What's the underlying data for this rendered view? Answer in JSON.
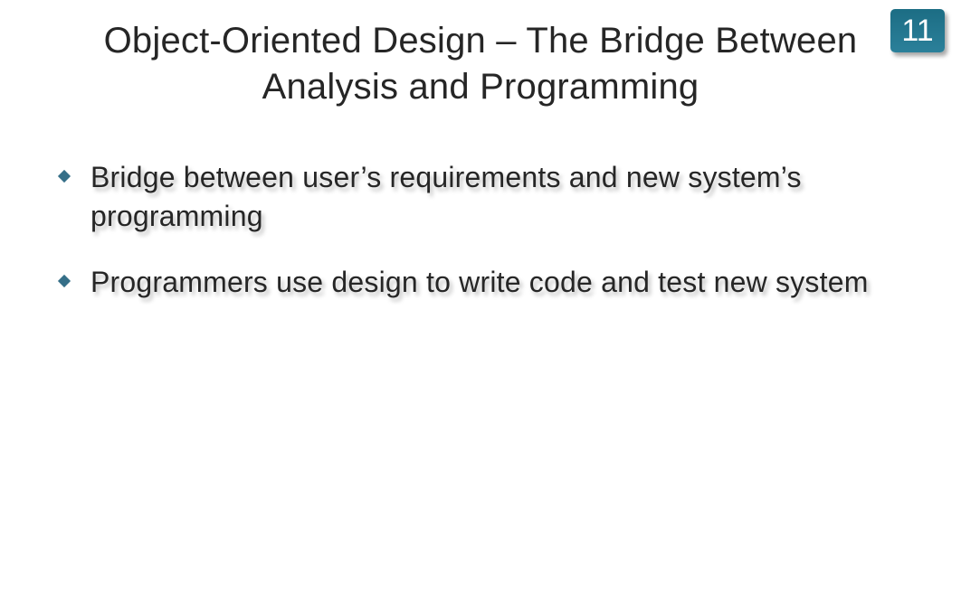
{
  "chapter_number": "11",
  "title": "Object-Oriented Design – The Bridge Between Analysis and Programming",
  "bullets": [
    "Bridge between user’s requirements and new system’s programming",
    "Programmers use design to write code and test new system"
  ]
}
